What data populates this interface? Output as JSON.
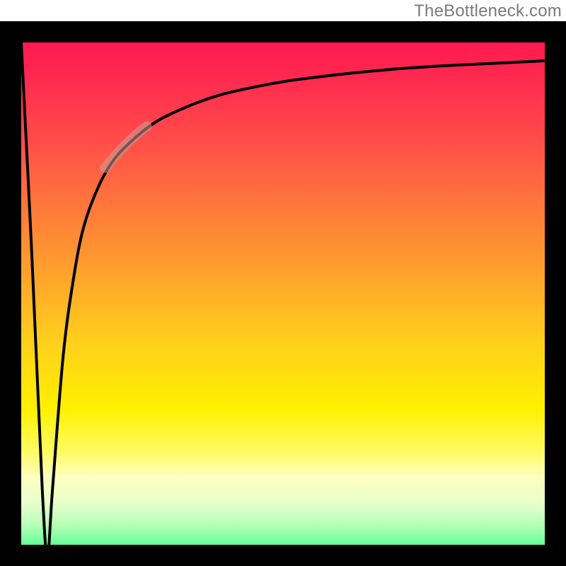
{
  "watermark": "TheBottleneck.com",
  "chart_data": {
    "type": "line",
    "title": "",
    "xlabel": "",
    "ylabel": "",
    "xlim": [
      0,
      100
    ],
    "ylim": [
      0,
      100
    ],
    "background_gradient": {
      "top": "#ff1a4f",
      "middle": "#fff000",
      "bottom": "#18ff88",
      "description": "vertical red-to-yellow-to-green gradient representing bottleneck severity"
    },
    "series": [
      {
        "name": "bottleneck-curve",
        "description": "V-shaped curve dipping near x≈5 then rising asymptotically",
        "x": [
          0,
          2,
          4,
          5,
          6,
          8,
          10,
          12,
          15,
          18,
          22,
          26,
          30,
          35,
          40,
          50,
          60,
          70,
          80,
          90,
          100
        ],
        "y": [
          100,
          60,
          15,
          2,
          15,
          40,
          55,
          65,
          73,
          78,
          82,
          85,
          87,
          89,
          90.5,
          92.5,
          93.8,
          94.8,
          95.5,
          96,
          96.5
        ]
      }
    ],
    "highlight": {
      "description": "thick semi-transparent tan overlay on curve segment",
      "x_range": [
        16,
        24
      ],
      "y_range": [
        76,
        84
      ],
      "color": "#c8a098",
      "opacity": 0.55
    },
    "notch": {
      "description": "small rounded notch at curve minimum",
      "x": 5,
      "y": 1
    }
  }
}
